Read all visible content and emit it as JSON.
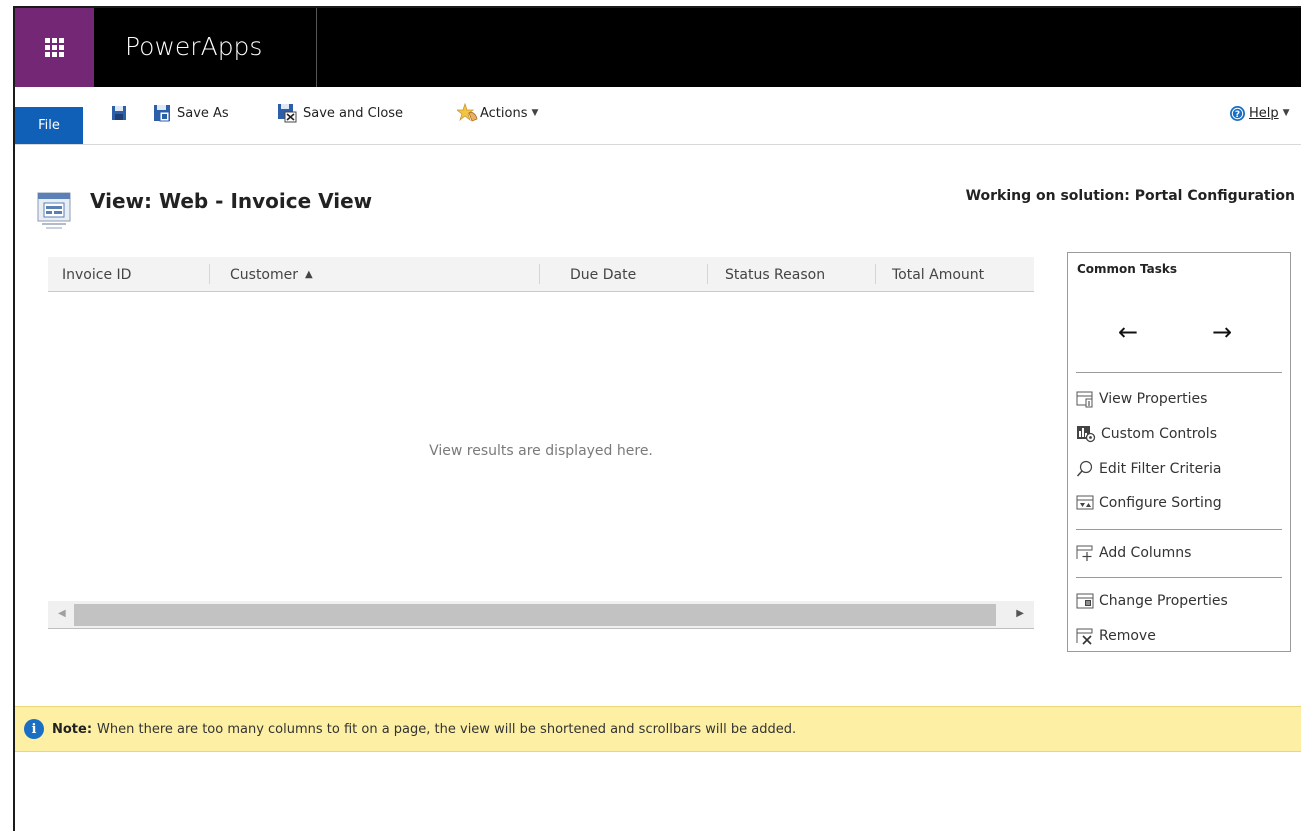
{
  "app": {
    "title": "PowerApps"
  },
  "toolbar": {
    "file_label": "File",
    "save_as_label": "Save As",
    "save_close_label": "Save and Close",
    "actions_label": "Actions",
    "help_label": "Help"
  },
  "page": {
    "title": "View: Web - Invoice View",
    "solution": "Working on solution: Portal Configuration"
  },
  "grid": {
    "columns": [
      {
        "label": "Invoice ID"
      },
      {
        "label": "Customer",
        "sorted": "ascending"
      },
      {
        "label": "Due Date"
      },
      {
        "label": "Status Reason"
      },
      {
        "label": "Total Amount"
      }
    ],
    "placeholder": "View results are displayed here."
  },
  "tasks": {
    "title": "Common Tasks",
    "items": [
      {
        "label": "View Properties",
        "icon": "view-properties-icon"
      },
      {
        "label": "Custom Controls",
        "icon": "custom-controls-icon"
      },
      {
        "label": "Edit Filter Criteria",
        "icon": "search-icon"
      },
      {
        "label": "Configure Sorting",
        "icon": "sort-icon"
      },
      {
        "label": "Add Columns",
        "icon": "add-columns-icon"
      },
      {
        "label": "Change Properties",
        "icon": "change-properties-icon"
      },
      {
        "label": "Remove",
        "icon": "remove-icon"
      }
    ]
  },
  "note": {
    "label": "Note:",
    "text": "When there are too many columns to fit on a page, the view will be shortened and scrollbars will be added."
  },
  "colors": {
    "brand_purple": "#742774",
    "file_blue": "#1160b7",
    "note_yellow": "#fdf0a4",
    "info_blue": "#1a6fc4"
  }
}
